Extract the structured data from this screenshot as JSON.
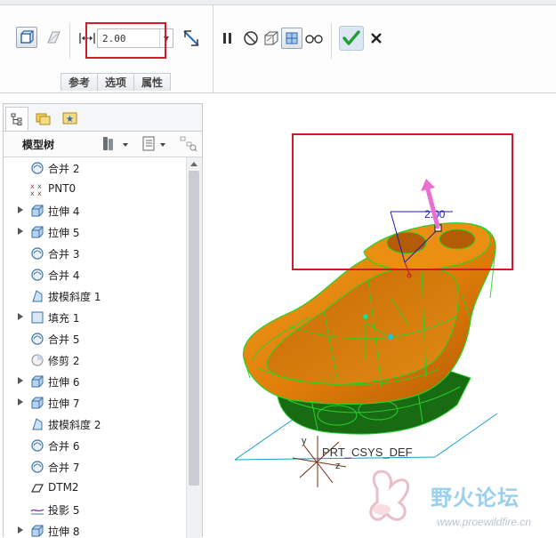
{
  "ribbon": {
    "depth_value": "2.00",
    "tabs": [
      "参考",
      "选项",
      "属性"
    ]
  },
  "toolbar_icons": [
    "solid-icon",
    "surface-icon",
    "depth-icon",
    "flip-direction-icon",
    "pause-icon",
    "no-preview-icon",
    "preview-icon",
    "verify-icon",
    "glasses-icon",
    "check-icon",
    "close-icon"
  ],
  "model_tree": {
    "title": "模型树",
    "items": [
      {
        "label": "合并 2",
        "icon": "merge",
        "expandable": false
      },
      {
        "label": "PNT0",
        "icon": "point",
        "expandable": false
      },
      {
        "label": "拉伸 4",
        "icon": "extrude",
        "expandable": true
      },
      {
        "label": "拉伸 5",
        "icon": "extrude",
        "expandable": true
      },
      {
        "label": "合并 3",
        "icon": "merge",
        "expandable": false
      },
      {
        "label": "合并 4",
        "icon": "merge",
        "expandable": false
      },
      {
        "label": "拔模斜度 1",
        "icon": "draft",
        "expandable": false
      },
      {
        "label": "填充 1",
        "icon": "fill",
        "expandable": true
      },
      {
        "label": "合并 5",
        "icon": "merge",
        "expandable": false
      },
      {
        "label": "修剪 2",
        "icon": "trim",
        "expandable": false
      },
      {
        "label": "拉伸 6",
        "icon": "extrude",
        "expandable": true
      },
      {
        "label": "拉伸 7",
        "icon": "extrude",
        "expandable": true
      },
      {
        "label": "拔模斜度 2",
        "icon": "draft",
        "expandable": false
      },
      {
        "label": "合并 6",
        "icon": "merge",
        "expandable": false
      },
      {
        "label": "合并 7",
        "icon": "merge",
        "expandable": false
      },
      {
        "label": "DTM2",
        "icon": "datum-plane",
        "expandable": false
      },
      {
        "label": "投影 5",
        "icon": "projection",
        "expandable": false
      },
      {
        "label": "拉伸 8",
        "icon": "extrude",
        "expandable": true
      }
    ]
  },
  "viewport": {
    "dimension_label": "2.00",
    "csys_label": "PRT_CSYS_DEF",
    "axis_labels": {
      "y": "y",
      "z": "z"
    },
    "colors": {
      "part_orange": "#e07f0a",
      "part_dark_orange": "#b85f06",
      "edge_green": "#28d22a",
      "bottom_green": "#186a13",
      "drag_arrow": "#e96fd0",
      "highlight_red": "#d11a2a"
    }
  },
  "watermark": {
    "cn": "野火论坛",
    "url": "www.proewildfire.cn"
  }
}
